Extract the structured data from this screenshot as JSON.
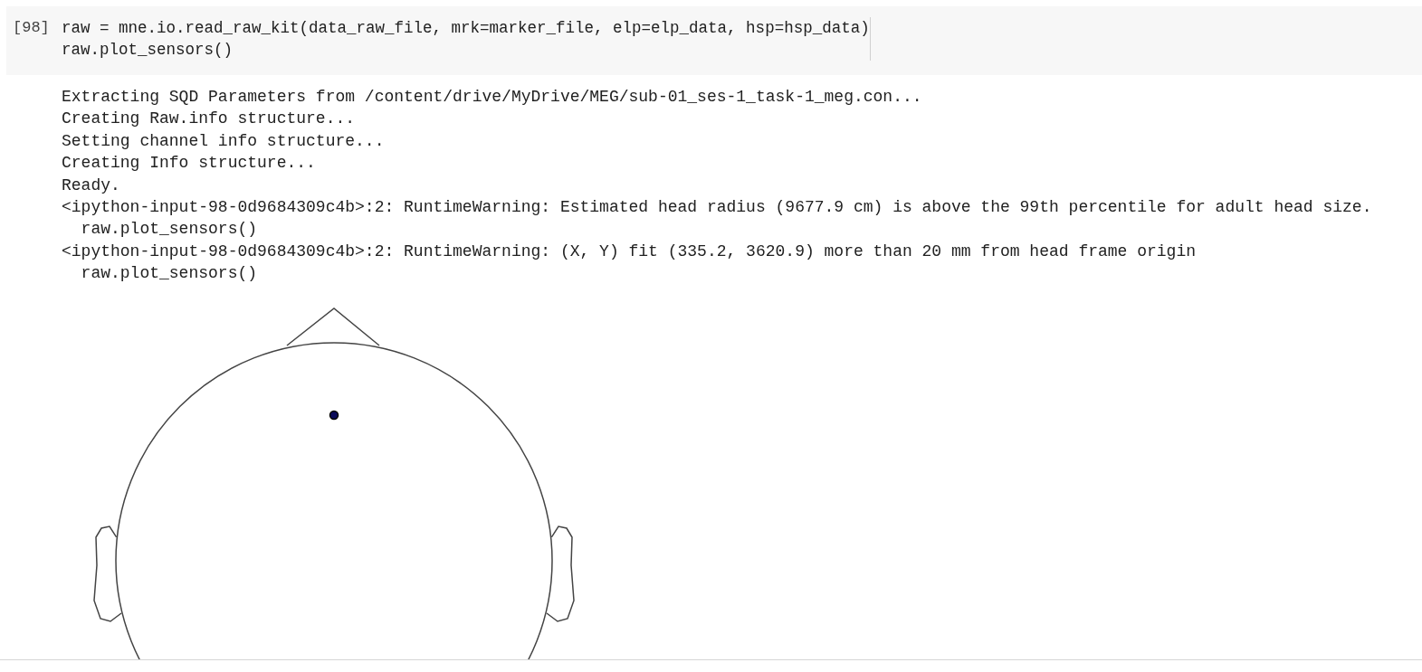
{
  "code_cell": {
    "prompt": "[98]",
    "code_lines": [
      "raw = mne.io.read_raw_kit(data_raw_file, mrk=marker_file, elp=elp_data, hsp=hsp_data)",
      "raw.plot_sensors()"
    ]
  },
  "output": {
    "lines": [
      "Extracting SQD Parameters from /content/drive/MyDrive/MEG/sub-01_ses-1_task-1_meg.con...",
      "Creating Raw.info structure...",
      "Setting channel info structure...",
      "Creating Info structure...",
      "Ready.",
      "<ipython-input-98-0d9684309c4b>:2: RuntimeWarning: Estimated head radius (9677.9 cm) is above the 99th percentile for adult head size.",
      "  raw.plot_sensors()",
      "<ipython-input-98-0d9684309c4b>:2: RuntimeWarning: (X, Y) fit (335.2, 3620.9) more than 20 mm from head frame origin",
      "  raw.plot_sensors()"
    ]
  }
}
